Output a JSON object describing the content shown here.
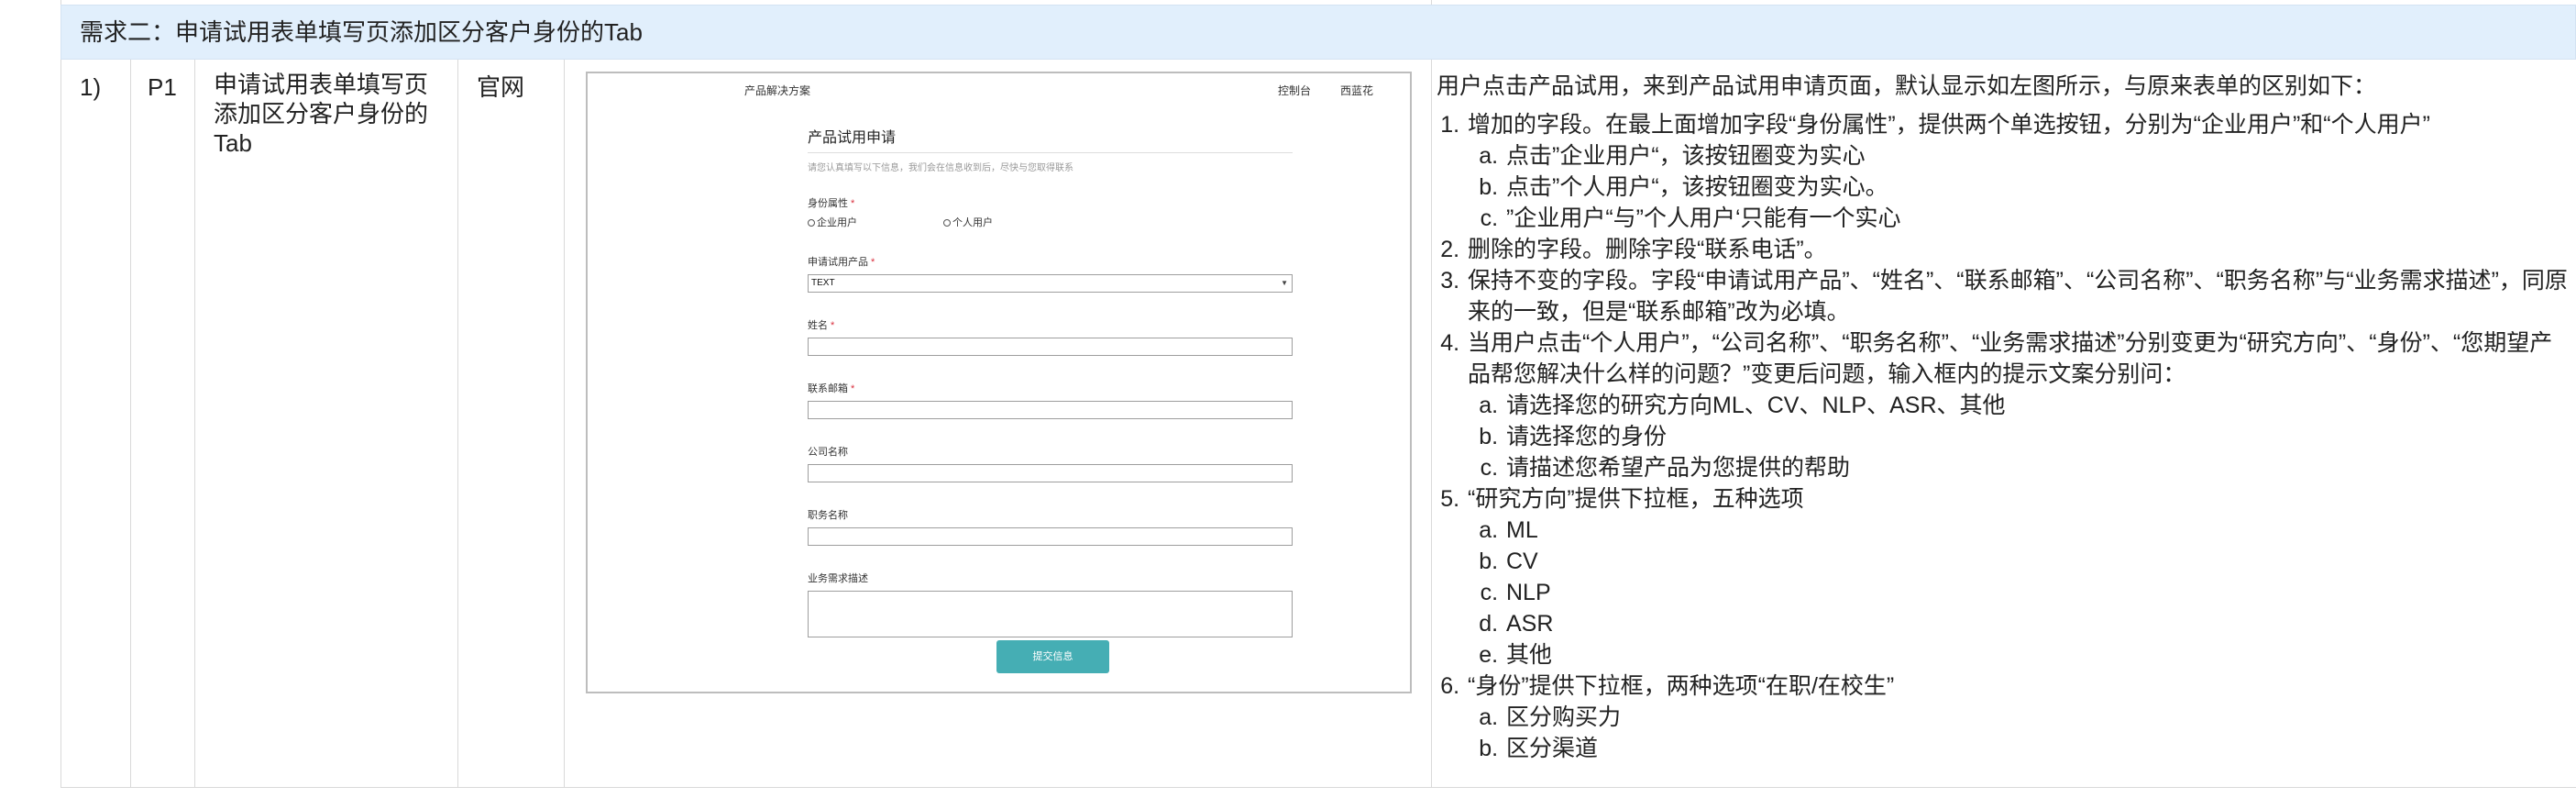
{
  "section": {
    "title": "需求二：申请试用表单填写页添加区分客户身份的Tab"
  },
  "row": {
    "index": "1)",
    "priority": "P1",
    "feature": "申请试用表单填写页添加区分客户身份的Tab",
    "platform": "官网"
  },
  "mockup": {
    "nav_left": "产品解决方案",
    "nav_console": "控制台",
    "nav_user": "西蓝花",
    "form_title": "产品试用申请",
    "form_subtitle": "请您认真填写以下信息，我们会在信息收到后，尽快与您取得联系",
    "identity_label": "身份属性",
    "radio_enterprise": "企业用户",
    "radio_personal": "个人用户",
    "product_label": "申请试用产品",
    "product_value": "TEXT",
    "name_label": "姓名",
    "email_label": "联系邮箱",
    "company_label": "公司名称",
    "position_label": "职务名称",
    "needs_label": "业务需求描述",
    "required_mark": "*",
    "submit_label": "提交信息"
  },
  "description": {
    "intro": "用户点击产品试用，来到产品试用申请页面，默认显示如左图所示，与原来表单的区别如下：",
    "items": [
      {
        "text": "增加的字段。在最上面增加字段“身份属性”，提供两个单选按钮，分别为“企业用户”和“个人用户”",
        "sub": [
          "点击”企业用户“，该按钮圈变为实心",
          "点击”个人用户“，该按钮圈变为实心。",
          "”企业用户“与”个人用户‘只能有一个实心"
        ]
      },
      {
        "text": "删除的字段。删除字段“联系电话”。",
        "sub": []
      },
      {
        "text": "保持不变的字段。字段“申请试用产品”、“姓名”、“联系邮箱”、“公司名称”、“职务名称”与“业务需求描述”，同原来的一致，但是“联系邮箱”改为必填。",
        "sub": []
      },
      {
        "text": "当用户点击“个人用户”，“公司名称”、“职务名称”、“业务需求描述”分别变更为“研究方向”、“身份”、“您期望产品帮您解决什么样的问题？”变更后问题，输入框内的提示文案分别问：",
        "sub": [
          "请选择您的研究方向ML、CV、NLP、ASR、其他",
          "请选择您的身份",
          "请描述您希望产品为您提供的帮助"
        ]
      },
      {
        "text": "“研究方向”提供下拉框，五种选项",
        "sub": [
          "ML",
          "CV",
          "NLP",
          "ASR",
          "其他"
        ]
      },
      {
        "text": "“身份”提供下拉框，两种选项“在职/在校生”",
        "sub": [
          "区分购买力",
          "区分渠道"
        ]
      }
    ]
  }
}
